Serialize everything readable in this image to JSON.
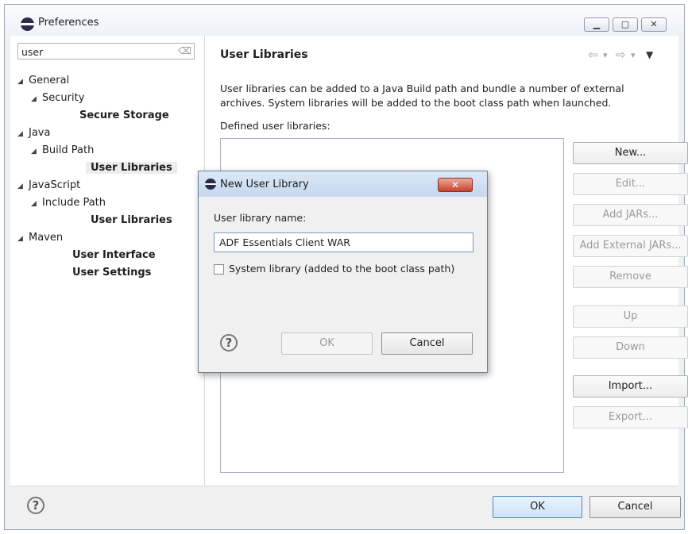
{
  "window": {
    "title": "Preferences",
    "minimize": "▁",
    "maximize": "▢",
    "close": "✕"
  },
  "filter": {
    "value": "user",
    "placeholder": ""
  },
  "tree": [
    {
      "label": "General",
      "level": 0,
      "bold": false,
      "expanded": true
    },
    {
      "label": "Security",
      "level": 1,
      "bold": false,
      "expanded": true
    },
    {
      "label": "Secure Storage",
      "level": 2,
      "bold": true
    },
    {
      "label": "Java",
      "level": 0,
      "bold": false,
      "expanded": true
    },
    {
      "label": "Build Path",
      "level": 1,
      "bold": false,
      "expanded": true
    },
    {
      "label": "User Libraries",
      "level": 2,
      "bold": true,
      "selected": true
    },
    {
      "label": "JavaScript",
      "level": 0,
      "bold": false,
      "expanded": true
    },
    {
      "label": "Include Path",
      "level": 1,
      "bold": false,
      "expanded": true
    },
    {
      "label": "User Libraries",
      "level": 2,
      "bold": true
    },
    {
      "label": "Maven",
      "level": 0,
      "bold": false,
      "expanded": true
    },
    {
      "label": "User Interface",
      "level": 2,
      "bold": true
    },
    {
      "label": "User Settings",
      "level": 2,
      "bold": true
    }
  ],
  "page": {
    "title": "User Libraries",
    "description": "User libraries can be added to a Java Build path and bundle a number of external archives. System libraries will be added to the boot class path when launched.",
    "defined_label": "Defined user libraries:"
  },
  "buttons": {
    "new": "New...",
    "edit": "Edit...",
    "add_jars": "Add JARs...",
    "add_external_jars": "Add External JARs...",
    "remove": "Remove",
    "up": "Up",
    "down": "Down",
    "import": "Import...",
    "export": "Export..."
  },
  "footer": {
    "help": "?",
    "ok": "OK",
    "cancel": "Cancel"
  },
  "dialog": {
    "title": "New User Library",
    "name_label": "User library name:",
    "name_value": "ADF Essentials Client WAR",
    "system_label": "System library (added to the boot class path)",
    "system_checked": false,
    "help": "?",
    "ok": "OK",
    "cancel": "Cancel",
    "close": "✕"
  },
  "nav_icons": {
    "back": "⇦",
    "fwd": "⇨",
    "dropdown": "▾",
    "menu": "▼"
  },
  "colors": {
    "dialog_title": "#c5d8ef",
    "close_button": "#c8432b",
    "default_button": "#4b87c4"
  }
}
